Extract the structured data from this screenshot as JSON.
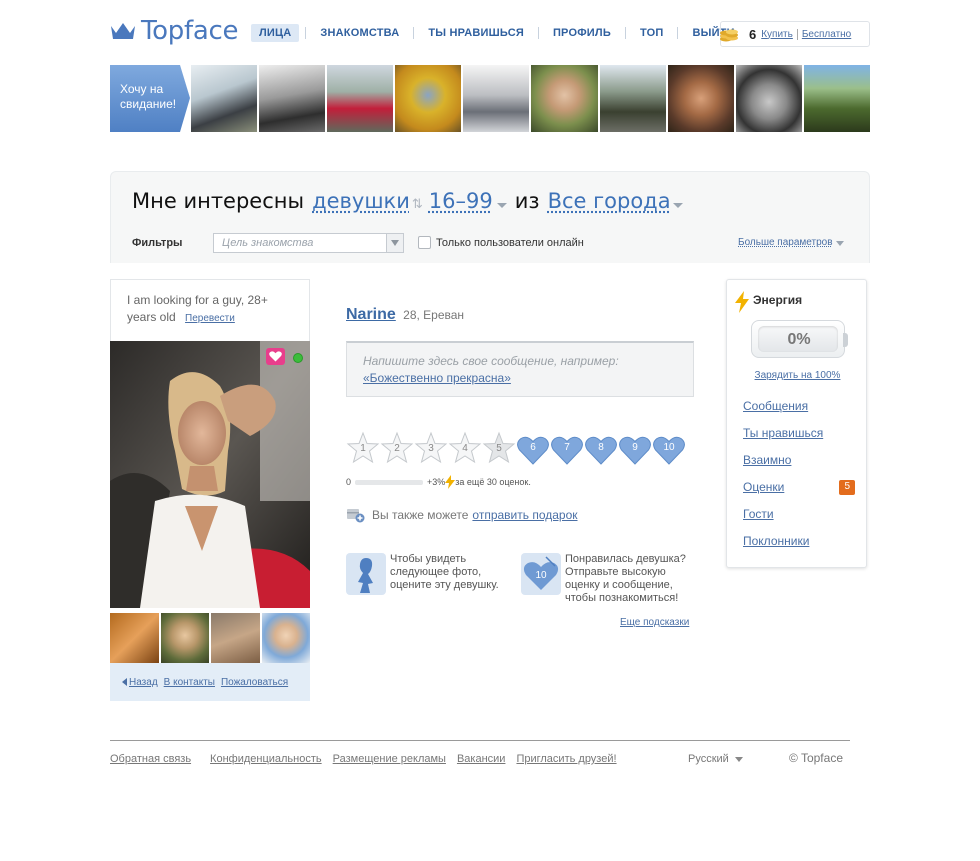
{
  "header": {
    "logo_text": "Topface",
    "nav": [
      {
        "label": "Лица",
        "active": true
      },
      {
        "label": "Знакомства",
        "active": false
      },
      {
        "label": "Ты нравишься",
        "active": false
      },
      {
        "label": "Профиль",
        "active": false
      },
      {
        "label": "Топ",
        "active": false
      },
      {
        "label": "Выйти",
        "active": false
      }
    ],
    "coins": {
      "count": "6",
      "buy_label": "Купить",
      "free_label": "Бесплатно"
    }
  },
  "strip": {
    "promo_line1": "Хочу на",
    "promo_line2": "свидание!"
  },
  "search": {
    "prefix": "Мне интересны",
    "gender": "девушки",
    "age": "16–99",
    "from_word": "из",
    "city": "Все города",
    "filters_label": "Фильтры",
    "purpose_placeholder": "Цель знакомства",
    "online_label": "Только пользователи онлайн",
    "more_params": "Больше параметров"
  },
  "profile": {
    "bio_text": "I am looking for a guy, 28+ years old",
    "translate_label": "Перевести",
    "name": "Narine",
    "age_city": "28, Ереван",
    "message_prompt": "Напишите здесь свое сообщение, например:",
    "message_example": "«Божественно прекрасна»",
    "nav_back": "Назад",
    "nav_contacts": "В контакты",
    "nav_report": "Пожаловаться"
  },
  "rating": {
    "marks": [
      "1",
      "2",
      "3",
      "4",
      "5",
      "6",
      "7",
      "8",
      "9",
      "10"
    ],
    "progress_start": "0",
    "progress_bonus": "+3%",
    "progress_note": "за ещё 30 оценок."
  },
  "gift": {
    "text": "Вы также можете",
    "link": "отправить подарок"
  },
  "hints": {
    "hint1": "Чтобы увидеть следующее фото, оцените эту девушку.",
    "hint2": "Понравилась девушка? Отправьте высокую оценку и сообщение, чтобы познакомиться!",
    "hint2_icon_value": "10",
    "more_hints": "Еще подсказки"
  },
  "energy": {
    "title": "Энергия",
    "percent": "0%",
    "charge_link": "Зарядить на 100%",
    "menu": [
      {
        "label": "Сообщения",
        "badge": ""
      },
      {
        "label": "Ты нравишься",
        "badge": ""
      },
      {
        "label": "Взаимно",
        "badge": ""
      },
      {
        "label": "Оценки",
        "badge": "5"
      },
      {
        "label": "Гости",
        "badge": ""
      },
      {
        "label": "Поклонники",
        "badge": ""
      }
    ]
  },
  "footer": {
    "links": [
      "Обратная связь",
      "Конфиденциальность",
      "Размещение рекламы",
      "Вакансии",
      "Пригласить друзей!"
    ],
    "language": "Русский",
    "copyright": "© Topface"
  },
  "colors": {
    "brand_blue": "#4a78bd",
    "link_blue": "#4a6fa5",
    "heart_blue": "#7fa7dc",
    "badge_orange": "#e36c1d",
    "online_green": "#3bbd3b",
    "like_pink": "#e83e8c"
  }
}
